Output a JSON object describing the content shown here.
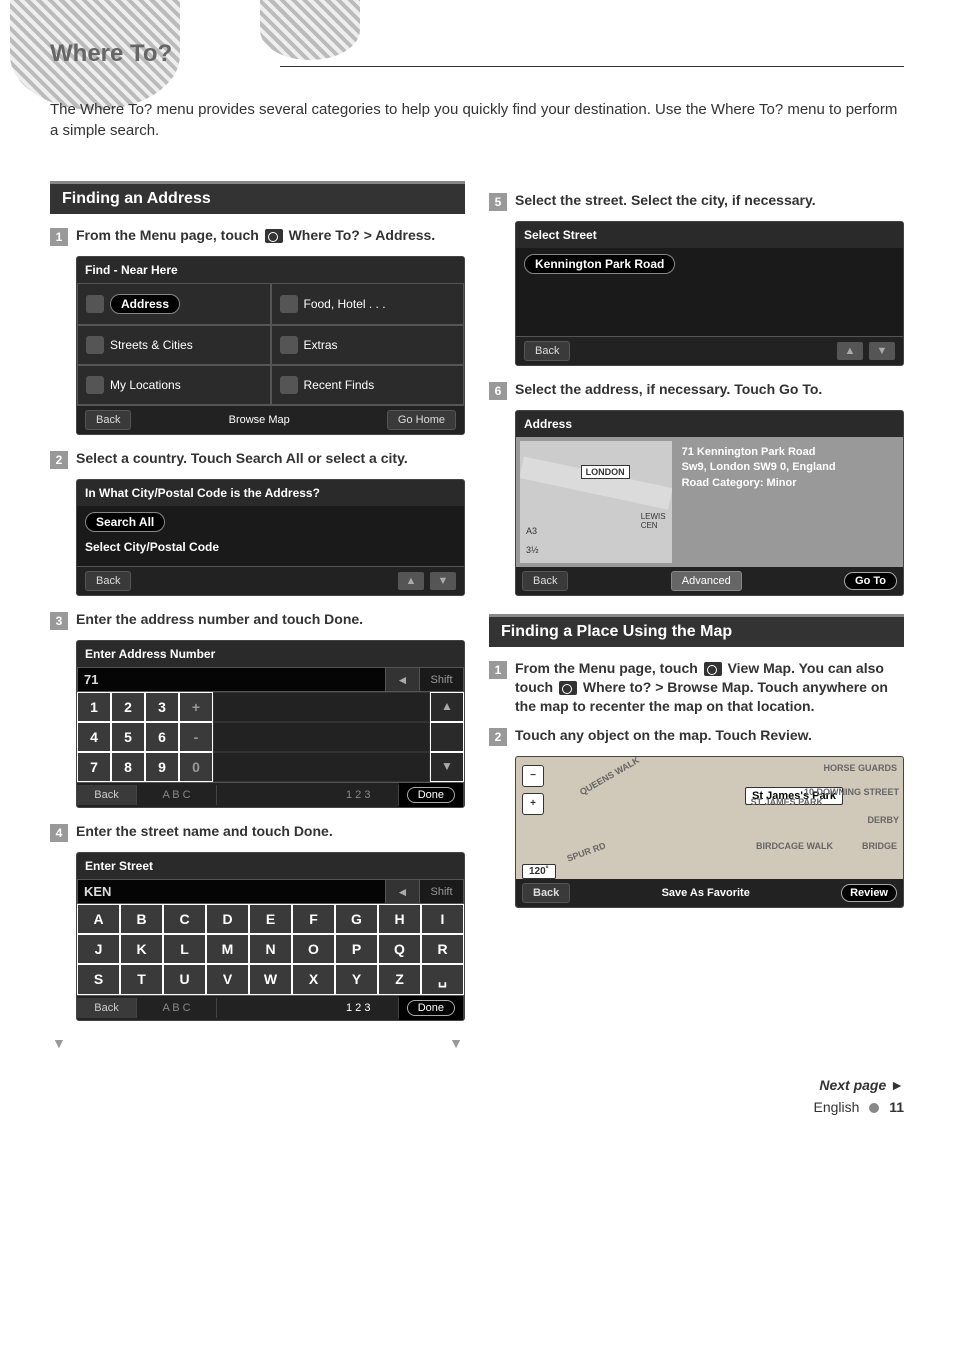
{
  "page_title": "Where To?",
  "intro": "The Where To? menu provides several categories to help you quickly find your destination. Use the Where To? menu to perform a simple search.",
  "left": {
    "section1_title": "Finding an Address",
    "step1": "From the Menu page, touch",
    "step1_suffix": "Where To? > Address.",
    "find_near_here": {
      "title": "Find - Near Here",
      "cells": [
        "Address",
        "Food, Hotel . . .",
        "Streets & Cities",
        "Extras",
        "My Locations",
        "Recent Finds"
      ],
      "footer": [
        "Back",
        "Browse Map",
        "Go Home"
      ]
    },
    "step2": "Select a country. Touch Search All or select a city.",
    "city_panel": {
      "title": "In What City/Postal Code is the Address?",
      "search_all": "Search All",
      "select_city": "Select City/Postal Code",
      "back": "Back"
    },
    "step3": "Enter the address number and touch Done.",
    "num_kb": {
      "title": "Enter Address Number",
      "input": "71",
      "shift": "Shift",
      "rows": [
        [
          "1",
          "2",
          "3",
          "+"
        ],
        [
          "4",
          "5",
          "6",
          "-"
        ],
        [
          "7",
          "8",
          "9",
          "0"
        ]
      ],
      "footer": {
        "back": "Back",
        "abc": "A B C",
        "num": "1 2 3",
        "done": "Done"
      }
    },
    "step4": "Enter the street name and touch Done.",
    "alpha_kb": {
      "title": "Enter Street",
      "input": "KEN",
      "shift": "Shift",
      "rows": [
        [
          "A",
          "B",
          "C",
          "D",
          "E",
          "F",
          "G",
          "H",
          "I"
        ],
        [
          "J",
          "K",
          "L",
          "M",
          "N",
          "O",
          "P",
          "Q",
          "R"
        ],
        [
          "S",
          "T",
          "U",
          "V",
          "W",
          "X",
          "Y",
          "Z",
          "␣"
        ]
      ],
      "footer": {
        "back": "Back",
        "abc": "A B C",
        "num": "1 2 3",
        "done": "Done"
      }
    }
  },
  "right": {
    "step5": "Select the street. Select the city, if necessary.",
    "sel_street": {
      "title": "Select Street",
      "item": "Kennington Park Road",
      "back": "Back"
    },
    "step6": "Select the address, if necessary. Touch Go To.",
    "addr_panel": {
      "title": "Address",
      "pin": "LONDON",
      "details": [
        "71 Kennington Park Road",
        "Sw9, London SW9 0, England",
        "",
        "Road Category: Minor"
      ],
      "footer": {
        "back": "Back",
        "adv": "Advanced",
        "goto": "Go To"
      }
    },
    "section2_title": "Finding a Place Using the Map",
    "step_m1_a": "From the Menu page, touch",
    "step_m1_b": "View Map. You can also touch",
    "step_m1_c": "Where to? > Browse Map. Touch anywhere on the map to recenter the map on that location.",
    "step_m2": "Touch any object on the map. Touch Review.",
    "browse_map": {
      "scale": "120˚",
      "callout": "St James's Park",
      "labels": [
        "QUEENS WALK",
        "ST JAMES PARK",
        "HORSE GUARDS",
        "10 DOWNING STREET",
        "DERBY",
        "BIRDCAGE WALK",
        "BRIDGE",
        "SPUR RD"
      ],
      "footer": {
        "back": "Back",
        "save": "Save As Favorite",
        "review": "Review"
      }
    }
  },
  "next_page": "Next page ►",
  "footer": {
    "lang": "English",
    "page": "11"
  }
}
